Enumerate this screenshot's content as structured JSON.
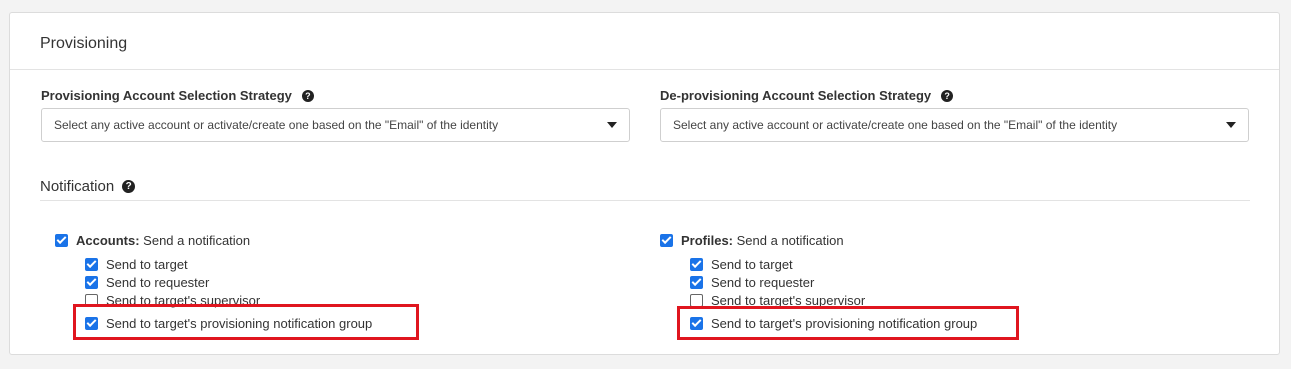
{
  "section_title": "Provisioning",
  "prov_strategy": {
    "label": "Provisioning Account Selection Strategy",
    "value": "Select any active account or activate/create one based on the \"Email\" of the identity"
  },
  "deprov_strategy": {
    "label": "De-provisioning Account Selection Strategy",
    "value": "Select any active account or activate/create one based on the \"Email\" of the identity"
  },
  "notification": {
    "title": "Notification",
    "accounts": {
      "bold": "Accounts:",
      "rest": " Send a notification",
      "checked": true,
      "items": [
        {
          "label": "Send to target",
          "checked": true
        },
        {
          "label": "Send to requester",
          "checked": true
        },
        {
          "label": "Send to target's supervisor",
          "checked": false
        },
        {
          "label": "Send to target's provisioning notification group",
          "checked": true
        }
      ]
    },
    "profiles": {
      "bold": "Profiles:",
      "rest": " Send a notification",
      "checked": true,
      "items": [
        {
          "label": "Send to target",
          "checked": true
        },
        {
          "label": "Send to requester",
          "checked": true
        },
        {
          "label": "Send to target's supervisor",
          "checked": false
        },
        {
          "label": "Send to target's provisioning notification group",
          "checked": true
        }
      ]
    }
  },
  "help_glyph": "?",
  "colors": {
    "accent": "#1a73e8",
    "highlight": "#e0161f"
  }
}
